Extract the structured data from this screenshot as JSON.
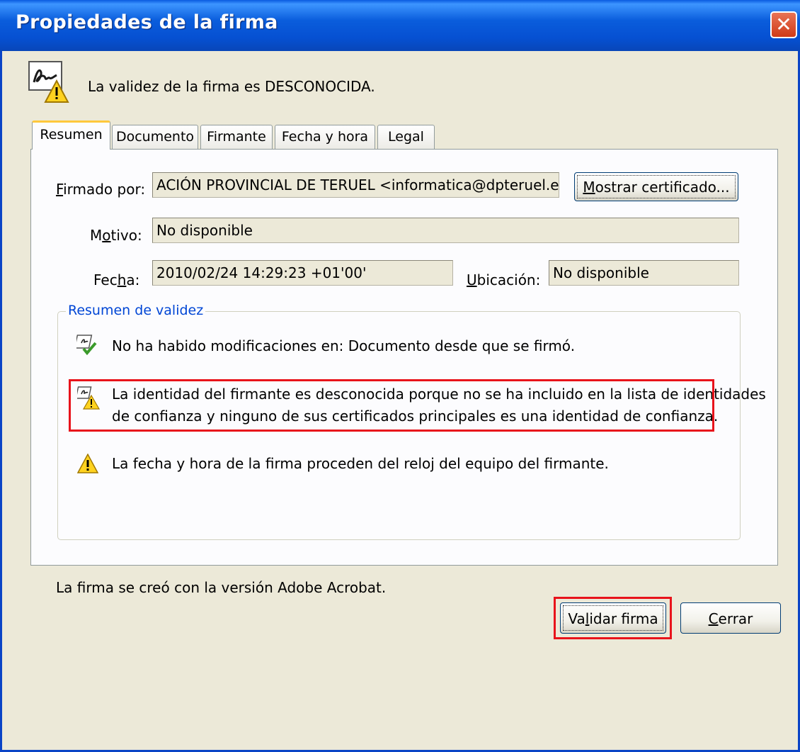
{
  "window": {
    "title": "Propiedades de la firma",
    "close_label": "✕"
  },
  "header": {
    "message": "La validez de la firma es DESCONOCIDA."
  },
  "tabs": [
    {
      "label": "Resumen",
      "active": true
    },
    {
      "label": "Documento",
      "active": false
    },
    {
      "label": "Firmante",
      "active": false
    },
    {
      "label": "Fecha y hora",
      "active": false
    },
    {
      "label": "Legal",
      "active": false
    }
  ],
  "fields": {
    "firmado_por": {
      "label_pre": "",
      "label_key": "F",
      "label_post": "irmado por:",
      "value": "ACIÓN PROVINCIAL DE TERUEL <informatica@dpteruel.es>"
    },
    "motivo": {
      "label_pre": "M",
      "label_key": "o",
      "label_post": "tivo:",
      "value": "No disponible"
    },
    "fecha": {
      "label_pre": "Fec",
      "label_key": "h",
      "label_post": "a:",
      "value": "2010/02/24 14:29:23 +01'00'"
    },
    "ubicacion": {
      "label_pre": "",
      "label_key": "U",
      "label_post": "bicación:",
      "value": "No disponible"
    }
  },
  "buttons": {
    "mostrar": {
      "pre": "",
      "key": "M",
      "post": "ostrar certificado..."
    },
    "validar": {
      "pre": "Va",
      "key": "l",
      "post": "idar firma"
    },
    "cerrar": {
      "pre": "",
      "key": "C",
      "post": "errar"
    }
  },
  "validity": {
    "title": "Resumen de validez",
    "items": [
      {
        "line1": "No ha habido modificaciones en: Documento desde que se firmó.",
        "icon": "doc-check-icon"
      },
      {
        "line1": "La identidad del firmante es desconocida porque no se ha incluido en la lista de identidades",
        "line2": "de confianza y ninguno de sus certificados principales es una identidad de confianza.",
        "icon": "doc-warning-icon"
      },
      {
        "line1": "La fecha y hora de la firma proceden del reloj del equipo del firmante.",
        "icon": "warning-icon"
      }
    ]
  },
  "footer": {
    "version_note": "La firma se creó con la versión Adobe Acrobat."
  },
  "colors": {
    "titlebar": "#0a5ddc",
    "dialog_bg": "#ece9d8",
    "panel_bg": "#fcfcfe",
    "highlight": "#e8131b",
    "group_title": "#0046d5",
    "tab_active_accent": "#ffc83c"
  }
}
